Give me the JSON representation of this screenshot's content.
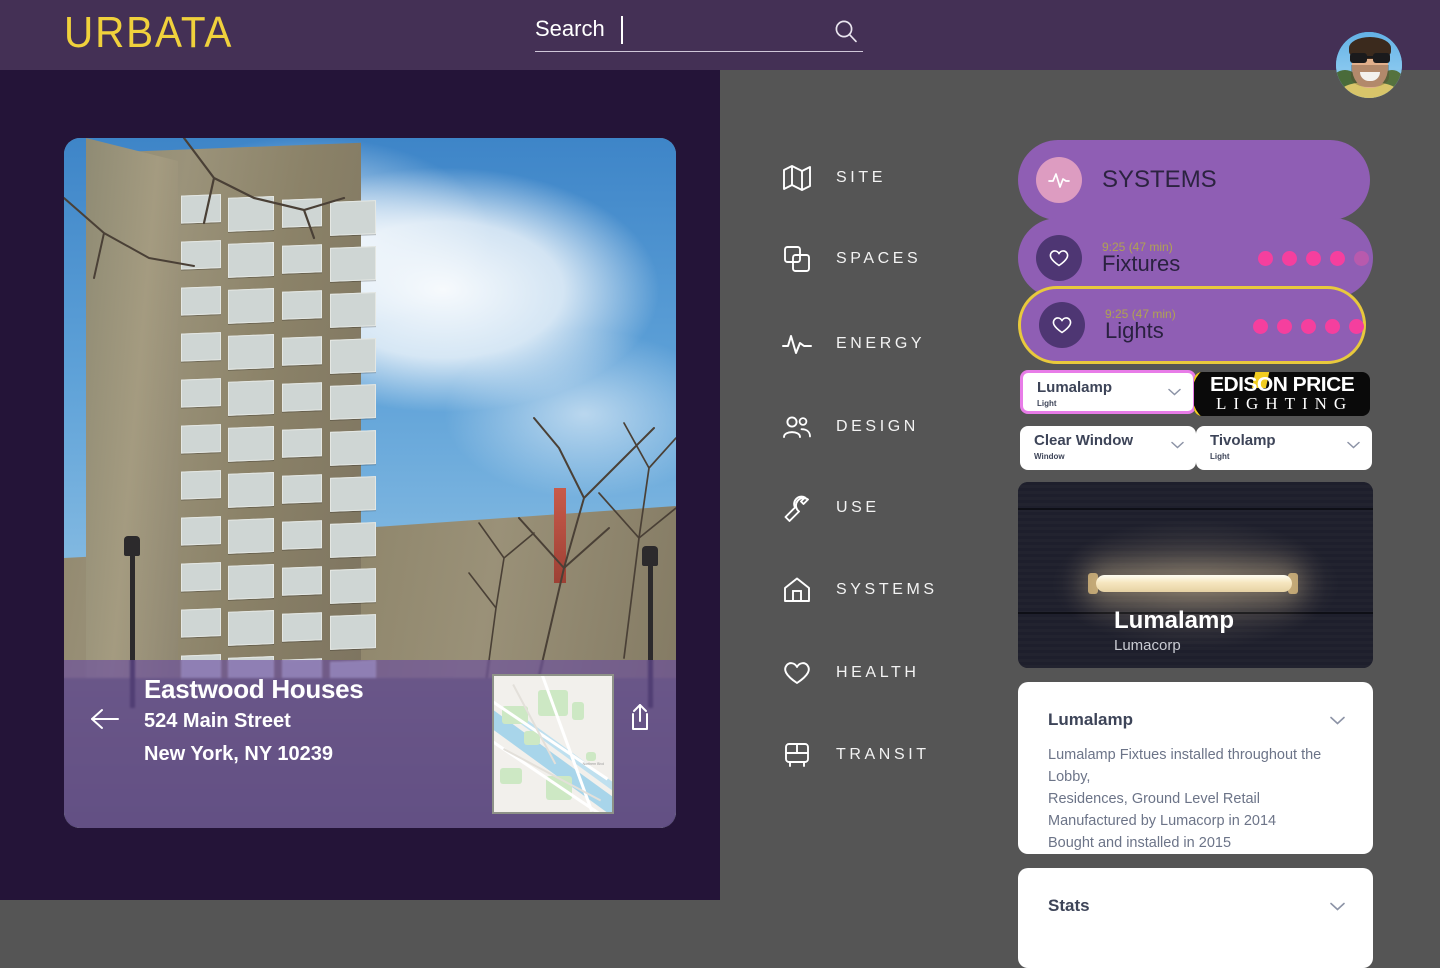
{
  "header": {
    "brand": "URBATA",
    "search_placeholder": "Search",
    "search_value": "",
    "search_icon": "search-icon",
    "avatar_alt": "user-avatar"
  },
  "building": {
    "name": "Eastwood Houses",
    "address_line1": "524 Main Street",
    "address_line2": "New York, NY 10239",
    "back_icon": "arrow-left-icon",
    "share_icon": "share-icon",
    "map_label": "Northern Blvd"
  },
  "nav": {
    "items": [
      {
        "label": "SITE",
        "icon": "map-icon"
      },
      {
        "label": "SPACES",
        "icon": "copy-icon"
      },
      {
        "label": "ENERGY",
        "icon": "activity-icon"
      },
      {
        "label": "DESIGN",
        "icon": "users-icon"
      },
      {
        "label": "USE",
        "icon": "wrench-icon"
      },
      {
        "label": "SYSTEMS",
        "icon": "home-icon"
      },
      {
        "label": "HEALTH",
        "icon": "heart-icon"
      },
      {
        "label": "TRANSIT",
        "icon": "bus-icon"
      }
    ]
  },
  "systems_panel": {
    "header": {
      "label": "SYSTEMS",
      "icon": "activity-icon"
    },
    "rows": [
      {
        "time": "9:25 (47 min)",
        "label": "Fixtures",
        "icon": "heart-icon",
        "dots_total": 5,
        "dots_active": 4,
        "selected": false
      },
      {
        "time": "9:25 (47 min)",
        "label": "Lights",
        "icon": "heart-icon",
        "dots_total": 5,
        "dots_active": 5,
        "selected": true
      }
    ]
  },
  "selectors": [
    {
      "name": "Lumalamp",
      "type": "Light",
      "highlighted": true,
      "chevron": "chevron-down-icon"
    },
    {
      "name": "Clear Window",
      "type": "Window",
      "highlighted": false,
      "chevron": "chevron-down-icon"
    },
    {
      "name": "Tivolamp",
      "type": "Light",
      "highlighted": false,
      "chevron": "chevron-down-icon"
    }
  ],
  "brand_logo": {
    "line1": "EDISON PRICE",
    "line2": "LIGHTING"
  },
  "product_image": {
    "title": "Lumalamp",
    "subtitle": "Lumacorp"
  },
  "detail_card": {
    "title": "Lumalamp",
    "chevron": "chevron-down-icon",
    "lines": [
      "Lumalamp Fixtues installed throughout the Lobby,",
      "Residences, Ground Level Retail",
      "Manufactured by Lumacorp in 2014",
      "Bought and installed in 2015"
    ]
  },
  "stats_card": {
    "title": "Stats",
    "chevron": "chevron-down-icon"
  },
  "colors": {
    "header_bg": "#443055",
    "left_panel_bg": "#241438",
    "right_panel_bg": "#555555",
    "brand_yellow": "#f0d13c",
    "pill_purple": "#8f5eb4",
    "selected_outline": "#e8c93c",
    "dot_pink": "#f53f9e",
    "highlight_pink": "#e87ce8",
    "card_white": "#ffffff",
    "text_slate": "#3d4458"
  }
}
